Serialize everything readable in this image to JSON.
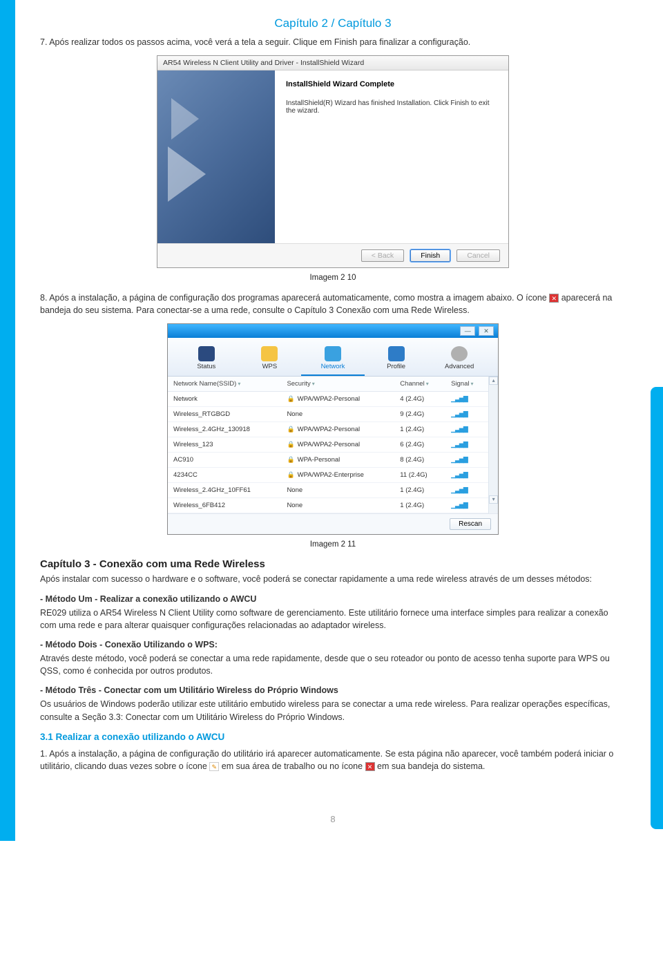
{
  "header": {
    "chapter": "Capítulo 2 / Capítulo 3"
  },
  "p7": "7. Após realizar todos os passos acima, você verá a tela a seguir. Clique em Finish para finalizar a configuração.",
  "wizard": {
    "title": "AR54 Wireless N Client Utility and Driver - InstallShield Wizard",
    "heading": "InstallShield Wizard Complete",
    "body": "InstallShield(R) Wizard has finished Installation. Click Finish to exit the wizard.",
    "back": "< Back",
    "finish": "Finish",
    "cancel": "Cancel"
  },
  "caption1": "Imagem 2 10",
  "p8a": "8. Após a instalação, a página de configuração dos programas aparecerá automaticamente, como mostra a imagem abaixo. O ícone ",
  "p8b": " aparecerá na bandeja do seu sistema. Para conectar-se a uma rede, consulte o Capítulo 3 Conexão com uma Rede Wireless.",
  "netwin": {
    "tabs": {
      "status": "Status",
      "wps": "WPS",
      "network": "Network",
      "profile": "Profile",
      "advanced": "Advanced"
    },
    "cols": {
      "ssid": "Network Name(SSID)",
      "security": "Security",
      "channel": "Channel",
      "signal": "Signal"
    },
    "rows": [
      {
        "ssid": "Network",
        "lock": true,
        "security": "WPA/WPA2-Personal",
        "channel": "4 (2.4G)"
      },
      {
        "ssid": "Wireless_RTGBGD",
        "lock": false,
        "security": "None",
        "channel": "9 (2.4G)"
      },
      {
        "ssid": "Wireless_2.4GHz_130918",
        "lock": true,
        "security": "WPA/WPA2-Personal",
        "channel": "1 (2.4G)"
      },
      {
        "ssid": "Wireless_123",
        "lock": true,
        "security": "WPA/WPA2-Personal",
        "channel": "6 (2.4G)"
      },
      {
        "ssid": "AC910",
        "lock": true,
        "security": "WPA-Personal",
        "channel": "8 (2.4G)"
      },
      {
        "ssid": "4234CC",
        "lock": true,
        "security": "WPA/WPA2-Enterprise",
        "channel": "11 (2.4G)"
      },
      {
        "ssid": "Wireless_2.4GHz_10FF61",
        "lock": false,
        "security": "None",
        "channel": "1 (2.4G)"
      },
      {
        "ssid": "Wireless_6FB412",
        "lock": false,
        "security": "None",
        "channel": "1 (2.4G)"
      }
    ],
    "rescan": "Rescan"
  },
  "caption2": "Imagem 2 11",
  "sec3": {
    "title": "Capítulo 3 - Conexão com uma Rede Wireless",
    "p1": "Após instalar com sucesso o hardware e o software, você poderá se conectar rapidamente a uma rede wireless através de um desses métodos:",
    "m1": "- Método Um - Realizar a conexão utilizando o AWCU",
    "m1t": "RE029 utiliza o AR54 Wireless N Client Utility como software de gerenciamento. Este utilitário fornece uma interface simples para realizar a conexão com uma rede e para alterar quaisquer configurações relacionadas ao adaptador wireless.",
    "m2": "- Método Dois - Conexão Utilizando o WPS:",
    "m2t": "Através deste método, você poderá se conectar a uma rede rapidamente, desde que o seu roteador ou ponto de acesso tenha suporte para WPS ou QSS, como é conhecida por outros produtos.",
    "m3": "- Método Três - Conectar com um Utilitário Wireless do Próprio Windows",
    "m3t": "Os usuários de Windows poderão utilizar este utilitário embutido wireless para se conectar a uma rede wireless. Para realizar operações específicas, consulte a Seção 3.3: Conectar com um Utilitário Wireless do Próprio Windows.",
    "sub": "3.1 Realizar a conexão utilizando o AWCU",
    "s1a": "1. Após a instalação, a página de configuração do utilitário irá aparecer automaticamente. Se esta página não aparecer, você também poderá iniciar o utilitário, clicando duas vezes sobre o ícone ",
    "s1b": " em sua área de trabalho ou no ícone ",
    "s1c": " em sua bandeja do sistema."
  },
  "pagenum": "8"
}
